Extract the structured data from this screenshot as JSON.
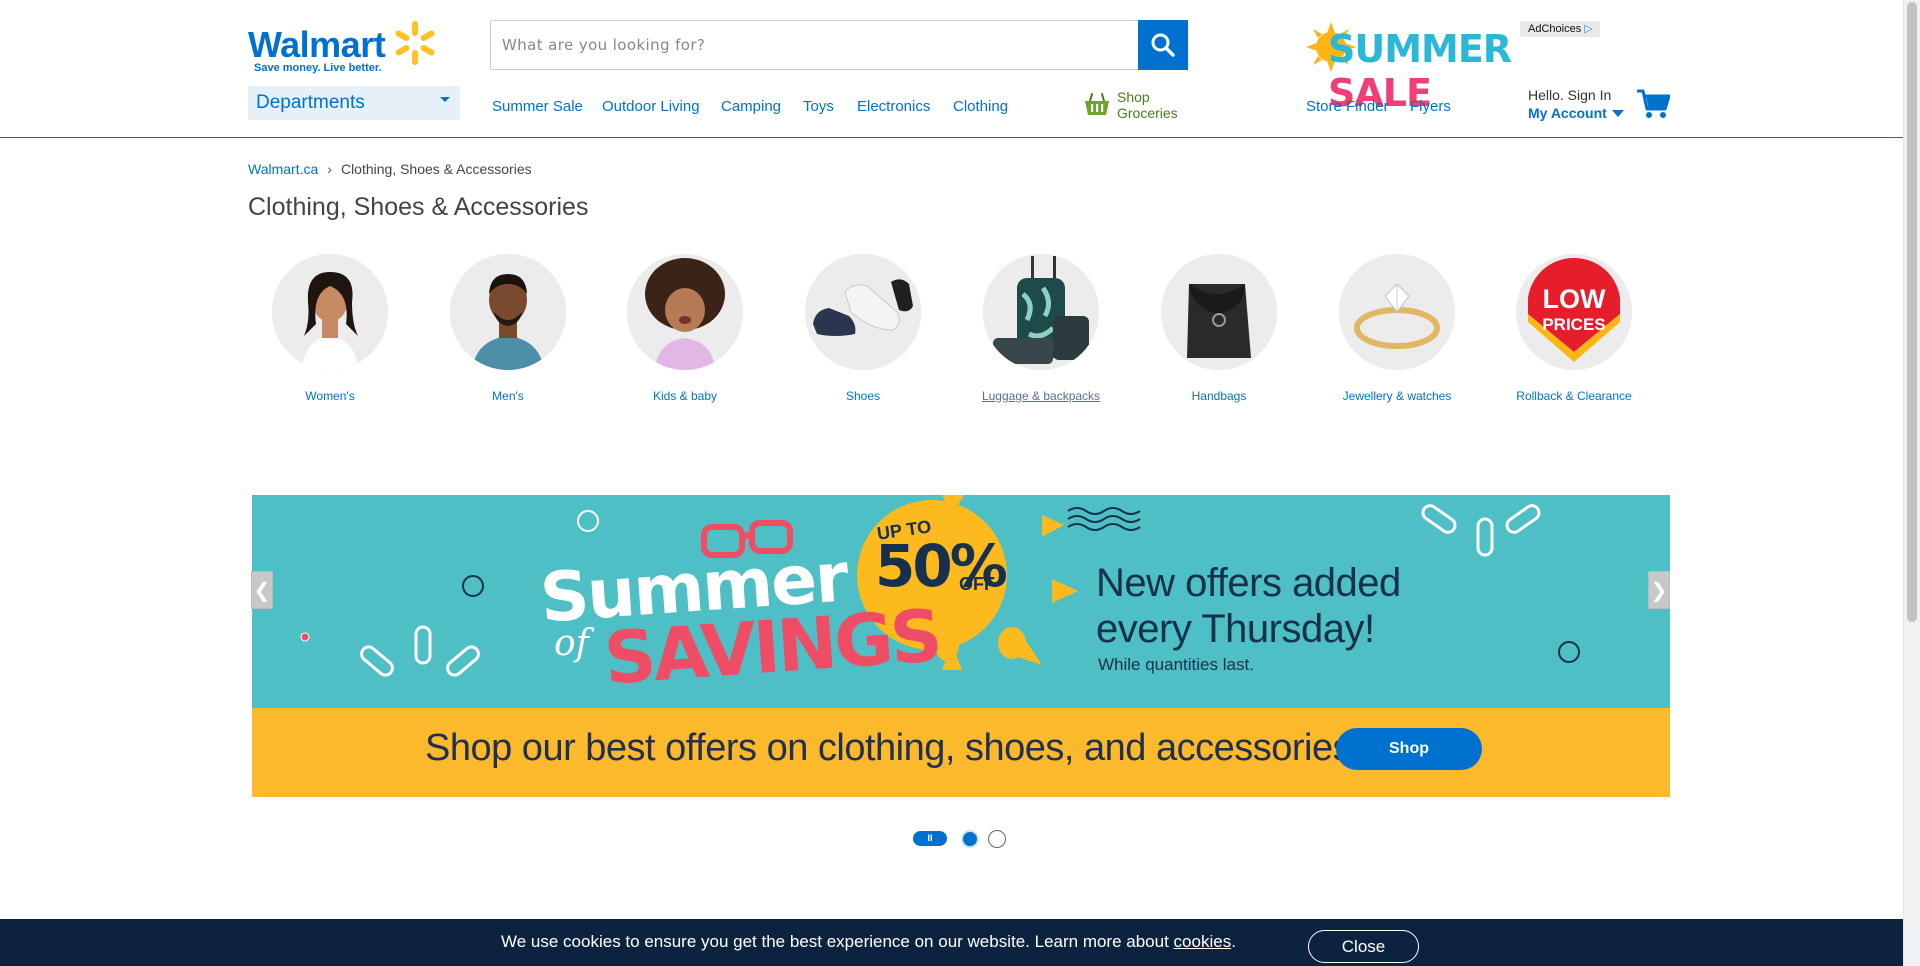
{
  "header": {
    "logo_word": "Walmart",
    "logo_tagline": "Save money. Live better.",
    "search": {
      "placeholder": "What are you looking for?",
      "value": ""
    },
    "ad": {
      "summer": "SUMMER ",
      "sale": "SALE",
      "adchoices": "AdChoices"
    },
    "departments_label": "Departments",
    "nav": [
      "Summer Sale",
      "Outdoor Living",
      "Camping",
      "Toys",
      "Electronics",
      "Clothing"
    ],
    "shop_groceries": "Shop Groceries",
    "store_finder": "Store Finder",
    "flyers": "Flyers",
    "account": {
      "greeting": "Hello. Sign In",
      "label": "My Account"
    },
    "brand_color": "#0071ce"
  },
  "breadcrumb": {
    "home": "Walmart.ca",
    "separator": "›",
    "current": "Clothing, Shoes & Accessories"
  },
  "page_title": "Clothing, Shoes & Accessories",
  "categories": [
    {
      "label": "Women's",
      "icon": "women-photo"
    },
    {
      "label": "Men's",
      "icon": "men-photo"
    },
    {
      "label": "Kids & baby",
      "icon": "kids-photo"
    },
    {
      "label": "Shoes",
      "icon": "shoes-photo"
    },
    {
      "label": "Luggage & backpacks",
      "icon": "luggage-photo"
    },
    {
      "label": "Handbags",
      "icon": "handbag-photo"
    },
    {
      "label": "Jewellery & watches",
      "icon": "ring-photo"
    },
    {
      "label": "Rollback & Clearance",
      "icon": "low-prices-badge"
    }
  ],
  "low_prices_badge": "LOW PRICES",
  "banner": {
    "summer": "Summer",
    "of": "of",
    "savings": "SAVINGS",
    "upto": "UP TO",
    "percent": "50%",
    "off": "OFF",
    "headline_line1": "New offers added",
    "headline_line2": "every Thursday!",
    "fine_print": "While quantities last.",
    "bottom_text": "Shop our best offers on clothing, shoes, and accessories.",
    "shop_button": "Shop",
    "prev": "❮",
    "next": "❯",
    "pause": "II",
    "active_slide": 1,
    "slide_count": 2
  },
  "cookie_bar": {
    "message": "We use cookies to ensure you get the best experience on our website. Learn more about ",
    "link": "cookies",
    "period": ".",
    "close": "Close"
  }
}
